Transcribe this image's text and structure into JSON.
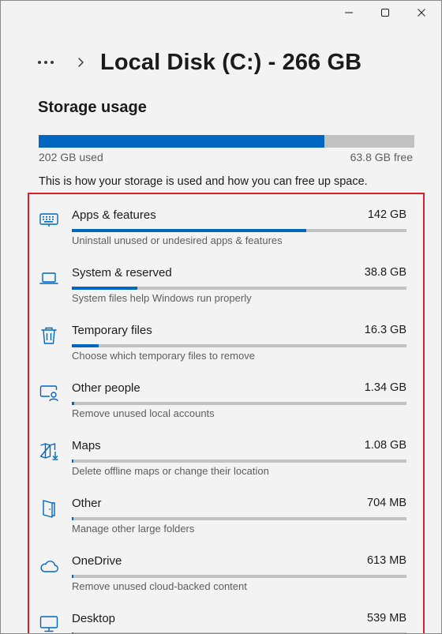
{
  "window": {
    "controls": {
      "minimize": "minimize",
      "maximize": "maximize",
      "close": "close"
    }
  },
  "header": {
    "more_icon": "more-horizontal-icon",
    "chevron_icon": "chevron-right-icon",
    "title": "Local Disk (C:) - 266 GB"
  },
  "storage": {
    "section_title": "Storage usage",
    "used_label": "202 GB used",
    "free_label": "63.8 GB free",
    "used_fraction": 0.76,
    "description": "This is how your storage is used and how you can free up space."
  },
  "colors": {
    "accent": "#0067c0",
    "highlight_border": "#d81f2a",
    "bar_track": "#c2c2c2",
    "background": "#f3f3f3"
  },
  "categories": [
    {
      "name": "Apps & features",
      "size": "142 GB",
      "subtitle": "Uninstall unused or undesired apps & features",
      "fraction": 0.7,
      "icon": "apps-icon"
    },
    {
      "name": "System & reserved",
      "size": "38.8 GB",
      "subtitle": "System files help Windows run properly",
      "fraction": 0.195,
      "icon": "laptop-icon"
    },
    {
      "name": "Temporary files",
      "size": "16.3 GB",
      "subtitle": "Choose which temporary files to remove",
      "fraction": 0.08,
      "icon": "trash-icon"
    },
    {
      "name": "Other people",
      "size": "1.34 GB",
      "subtitle": "Remove unused local accounts",
      "fraction": 0.007,
      "icon": "person-screen-icon"
    },
    {
      "name": "Maps",
      "size": "1.08 GB",
      "subtitle": "Delete offline maps or change their location",
      "fraction": 0.005,
      "icon": "map-icon"
    },
    {
      "name": "Other",
      "size": "704 MB",
      "subtitle": "Manage other large folders",
      "fraction": 0.004,
      "icon": "folder-icon"
    },
    {
      "name": "OneDrive",
      "size": "613 MB",
      "subtitle": "Remove unused cloud-backed content",
      "fraction": 0.003,
      "icon": "cloud-icon"
    },
    {
      "name": "Desktop",
      "size": "539 MB",
      "subtitle": "",
      "fraction": 0.003,
      "icon": "desktop-icon"
    }
  ]
}
